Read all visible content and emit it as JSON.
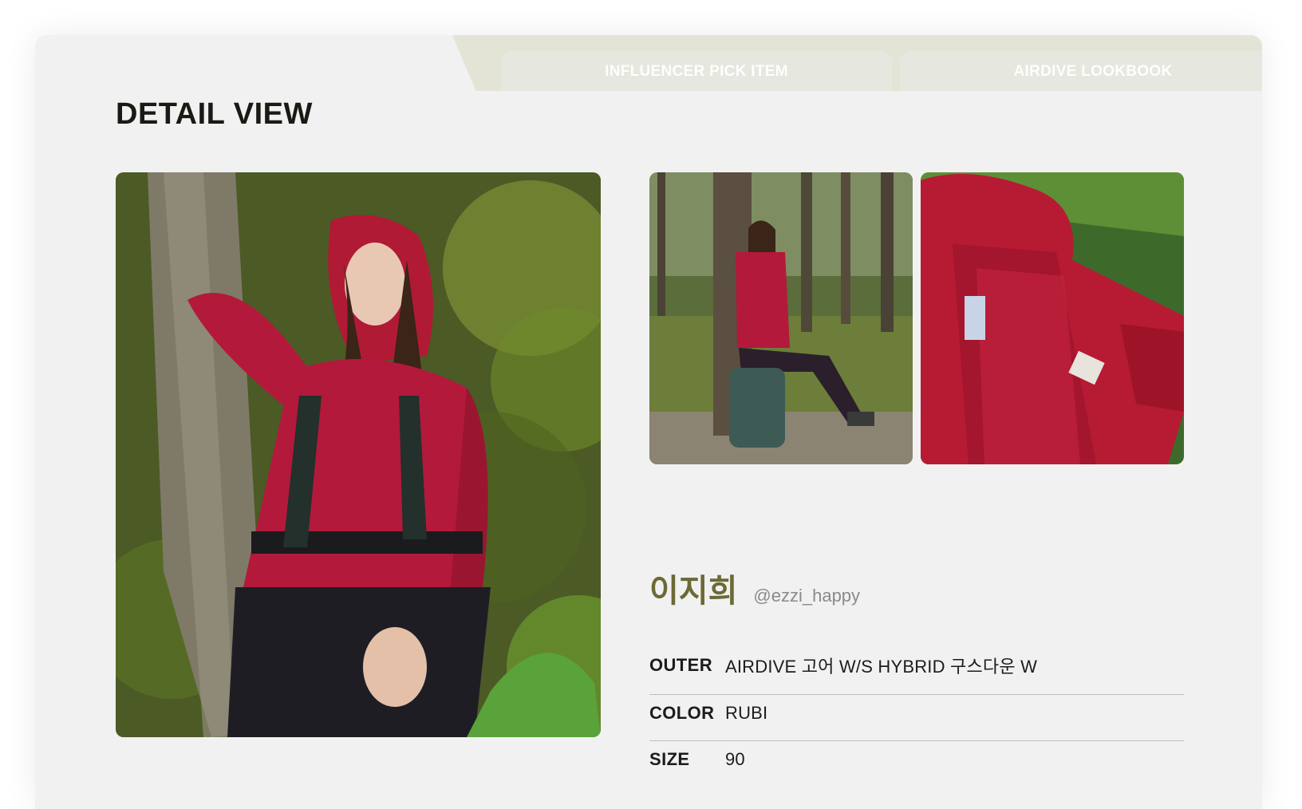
{
  "page": {
    "title": "DETAIL VIEW",
    "tabs": [
      {
        "label": "INFLUENCER PICK ITEM"
      },
      {
        "label": "AIRDIVE LOOKBOOK"
      }
    ]
  },
  "influencer": {
    "name": "이지희",
    "handle": "@ezzi_happy"
  },
  "specs": [
    {
      "key": "OUTER",
      "value": "AIRDIVE 고어 W/S HYBRID 구스다운 W"
    },
    {
      "key": "COLOR",
      "value": "RUBI"
    },
    {
      "key": "SIZE",
      "value": "90"
    }
  ],
  "colors": {
    "accent_name": "#6b6a36",
    "panel_bg": "#f1f1f1",
    "tab_strip": "#e3e4d6",
    "jacket_red": "#b3193a"
  }
}
